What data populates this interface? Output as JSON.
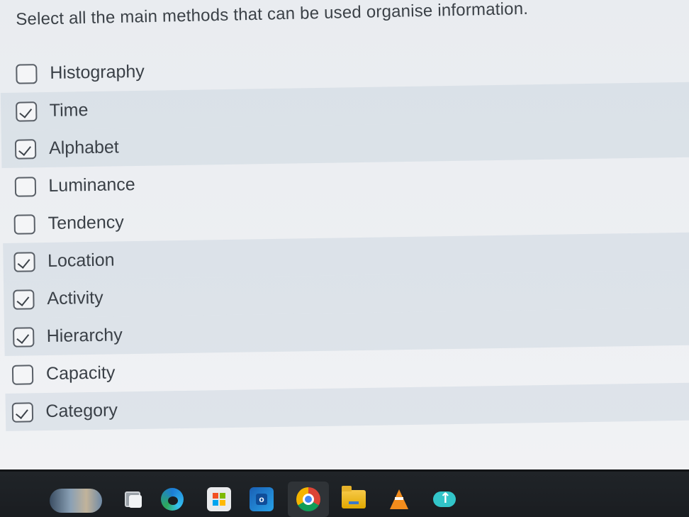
{
  "question": "Select all the main methods that can be used organise information.",
  "options": [
    {
      "label": "Histography",
      "checked": false
    },
    {
      "label": "Time",
      "checked": true
    },
    {
      "label": "Alphabet",
      "checked": true
    },
    {
      "label": "Luminance",
      "checked": false
    },
    {
      "label": "Tendency",
      "checked": false
    },
    {
      "label": "Location",
      "checked": true
    },
    {
      "label": "Activity",
      "checked": true
    },
    {
      "label": "Hierarchy",
      "checked": true
    },
    {
      "label": "Capacity",
      "checked": false
    },
    {
      "label": "Category",
      "checked": true
    }
  ],
  "taskbar": {
    "icons": [
      "widgets-icon",
      "task-view-icon",
      "edge-icon",
      "microsoft-store-icon",
      "outlook-icon",
      "chrome-icon",
      "file-explorer-icon",
      "vlc-icon",
      "cloud-upload-icon"
    ]
  },
  "colors": {
    "text": "#3a4047",
    "checkbox_border": "#5a6068",
    "taskbar": "#1a1d21",
    "row_shade": "#c8d2de"
  }
}
